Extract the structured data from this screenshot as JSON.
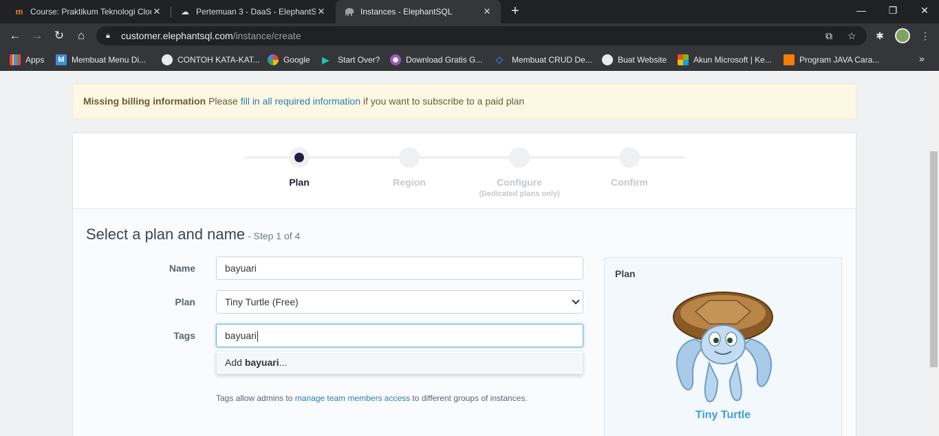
{
  "browser": {
    "tabs": [
      {
        "title": "Course: Praktikum Teknologi Cloud",
        "icon": "moodle-icon",
        "active": false
      },
      {
        "title": "Pertemuan 3 - DaaS - ElephantSQL",
        "icon": "cloud-icon",
        "active": false
      },
      {
        "title": "Instances - ElephantSQL",
        "icon": "elephant-icon",
        "active": true
      }
    ],
    "url_host": "customer.elephantsql.com",
    "url_path": "/instance/create",
    "bookmarks": [
      {
        "label": "Apps",
        "icon": "apps-grid-icon"
      },
      {
        "label": "Membuat Menu Di...",
        "icon": "m-icon"
      },
      {
        "label": "CONTOH KATA-KAT...",
        "icon": "globe-icon"
      },
      {
        "label": "Google",
        "icon": "google-icon"
      },
      {
        "label": "Start Over?",
        "icon": "play-icon"
      },
      {
        "label": "Download Gratis G...",
        "icon": "download-icon"
      },
      {
        "label": "Membuat CRUD De...",
        "icon": "code-icon"
      },
      {
        "label": "Buat Website",
        "icon": "globe-icon"
      },
      {
        "label": "Akun Microsoft | Ke...",
        "icon": "microsoft-icon"
      },
      {
        "label": "Program JAVA Cara...",
        "icon": "blogger-icon"
      }
    ]
  },
  "alert": {
    "strong": "Missing billing information",
    "pre": " Please ",
    "link": "fill in all required information",
    "post": " if you want to subscribe to a paid plan"
  },
  "steps": [
    {
      "label": "Plan",
      "sub": "",
      "active": true
    },
    {
      "label": "Region",
      "sub": "",
      "active": false
    },
    {
      "label": "Configure",
      "sub": "(Dedicated plans only)",
      "active": false
    },
    {
      "label": "Confirm",
      "sub": "",
      "active": false
    }
  ],
  "form": {
    "heading": "Select a plan and name",
    "heading_sub": " - Step 1 of 4",
    "name_label": "Name",
    "name_value": "bayuari",
    "plan_label": "Plan",
    "plan_value": "Tiny Turtle (Free)",
    "tags_label": "Tags",
    "tags_value": "bayuari",
    "suggest_prefix": "Add ",
    "suggest_bold": "bayuari",
    "suggest_suffix": "...",
    "help_pre": "Tags allow admins to ",
    "help_link": "manage team members access",
    "help_post": " to different groups of instances."
  },
  "plan_panel": {
    "title": "Plan",
    "plan_name": "Tiny Turtle"
  },
  "colors": {
    "accent": "#241d45",
    "link": "#2c7cb0",
    "plan_name": "#3ea0d8",
    "alert_bg": "#fcf8e3"
  }
}
